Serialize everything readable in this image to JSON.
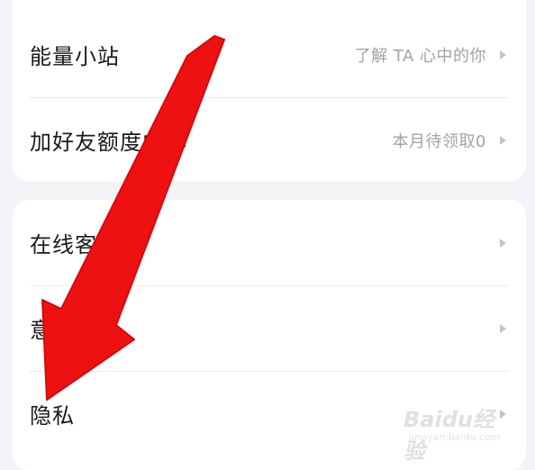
{
  "section1": {
    "items": [
      {
        "label": "能量小站",
        "value": "了解 TA 心中的你"
      },
      {
        "label": "加好友额度中心",
        "value": "本月待领取0"
      }
    ]
  },
  "section2": {
    "items": [
      {
        "label": "在线客服"
      },
      {
        "label": "意见反馈"
      },
      {
        "label": "隐私"
      }
    ]
  },
  "annotation": {
    "arrow_color": "#ee1111"
  },
  "watermark": {
    "brand": "Baidu经验",
    "url": "jingyan.baidu.com"
  }
}
